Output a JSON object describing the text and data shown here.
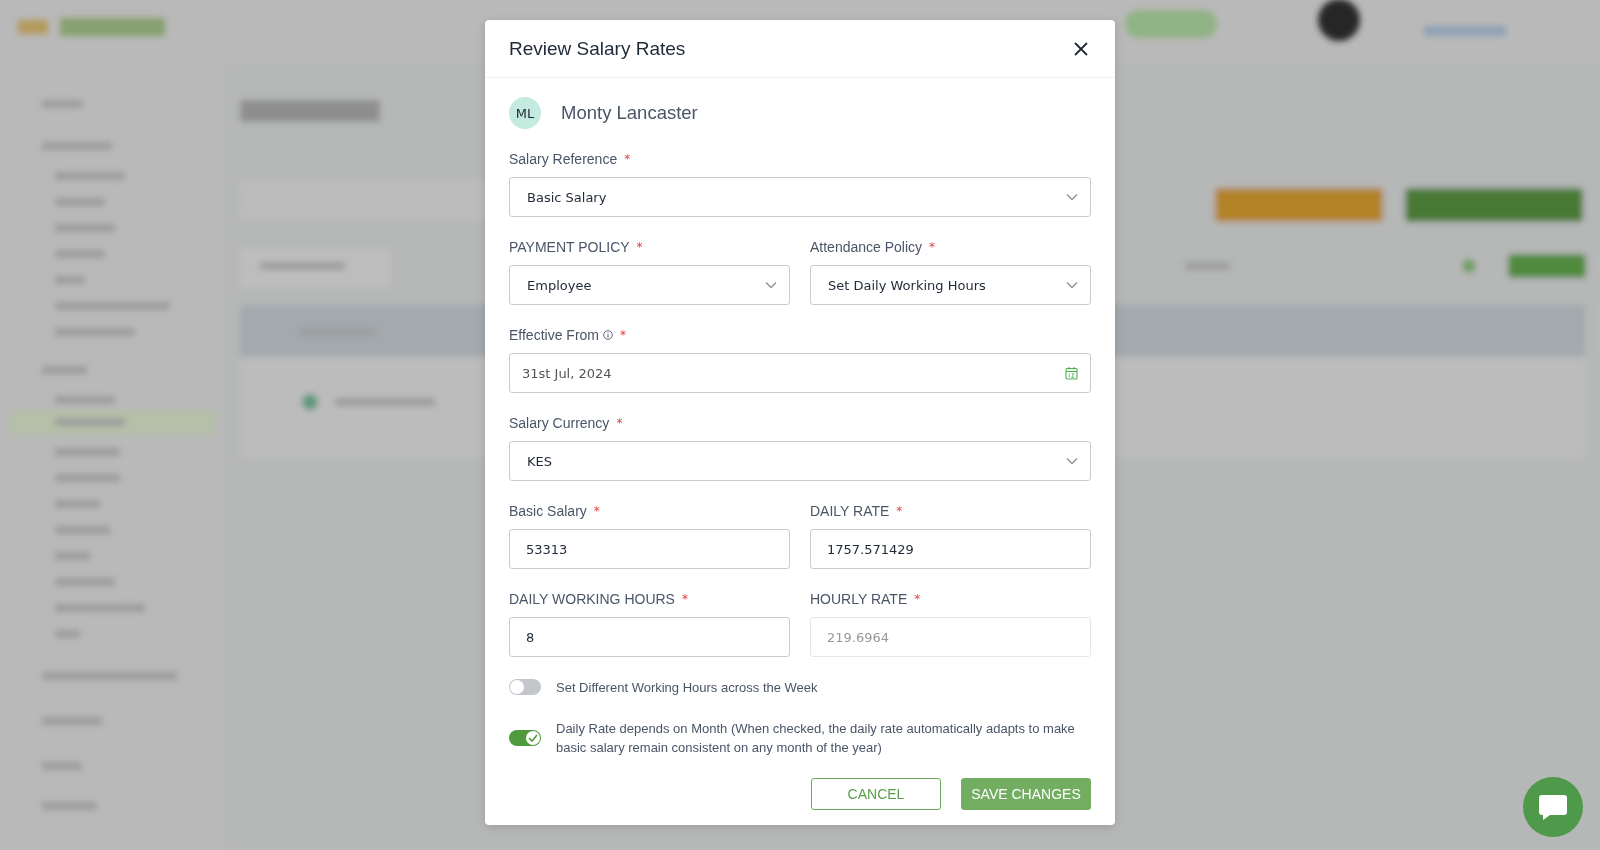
{
  "dialog": {
    "title": "Review Salary Rates",
    "required_mark": "*",
    "employee": {
      "initials": "ML",
      "name": "Monty Lancaster"
    },
    "rows": [
      [
        {
          "kind": "select",
          "label": "Salary Reference",
          "required": true,
          "value": "Basic Salary"
        }
      ],
      [
        {
          "kind": "select",
          "label": "PAYMENT POLICY",
          "required": true,
          "value": "Employee"
        },
        {
          "kind": "select",
          "label": "Attendance Policy",
          "required": true,
          "value": "Set Daily Working Hours"
        }
      ],
      [
        {
          "kind": "date",
          "label": "Effective From",
          "info": true,
          "required": true,
          "value": "31st Jul, 2024"
        }
      ],
      [
        {
          "kind": "select",
          "label": "Salary Currency",
          "required": true,
          "value": "KES"
        }
      ],
      [
        {
          "kind": "text",
          "label": "Basic Salary",
          "required": true,
          "value": "53313"
        },
        {
          "kind": "text",
          "label": "DAILY RATE",
          "required": true,
          "value": "1757.571429"
        }
      ],
      [
        {
          "kind": "text",
          "label": "DAILY WORKING HOURS",
          "required": true,
          "value": "8"
        },
        {
          "kind": "text",
          "label": "HOURLY RATE",
          "required": true,
          "disabled": true,
          "value": "219.6964"
        }
      ]
    ],
    "toggles": [
      {
        "label": "Set Different Working Hours across the Week",
        "on": false
      },
      {
        "label": "Daily Rate depends on Month (When checked, the daily rate automatically adapts to make basic salary remain consistent on any month of the year)",
        "on": true
      }
    ],
    "buttons": [
      {
        "label": "CANCEL",
        "kind": "outline"
      },
      {
        "label": "SAVE CHANGES",
        "kind": "primary"
      }
    ]
  }
}
